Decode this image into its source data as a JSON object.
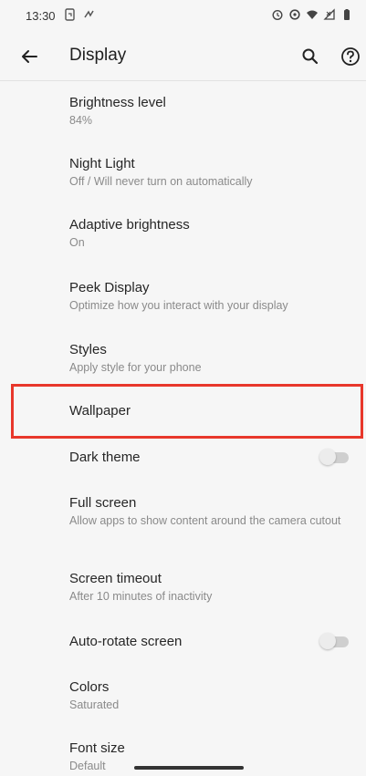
{
  "status": {
    "time": "13:30"
  },
  "appbar": {
    "title": "Display"
  },
  "items": [
    {
      "title": "Brightness level",
      "subtitle": "84%"
    },
    {
      "title": "Night Light",
      "subtitle": "Off / Will never turn on automatically"
    },
    {
      "title": "Adaptive brightness",
      "subtitle": "On"
    },
    {
      "title": "Peek Display",
      "subtitle": "Optimize how you interact with your display"
    },
    {
      "title": "Styles",
      "subtitle": "Apply style for your phone"
    },
    {
      "title": "Wallpaper"
    },
    {
      "title": "Dark theme",
      "toggle": false
    },
    {
      "title": "Full screen",
      "subtitle": "Allow apps to show content around the camera cutout"
    },
    {
      "title": "Screen timeout",
      "subtitle": "After 10 minutes of inactivity"
    },
    {
      "title": "Auto-rotate screen",
      "toggle": false
    },
    {
      "title": "Colors",
      "subtitle": "Saturated"
    },
    {
      "title": "Font size",
      "subtitle": "Default"
    }
  ],
  "colors": {
    "highlight": "#e8372b",
    "background": "#f6f6f6"
  },
  "icons": [
    "back-arrow-icon",
    "search-icon",
    "help-icon"
  ]
}
